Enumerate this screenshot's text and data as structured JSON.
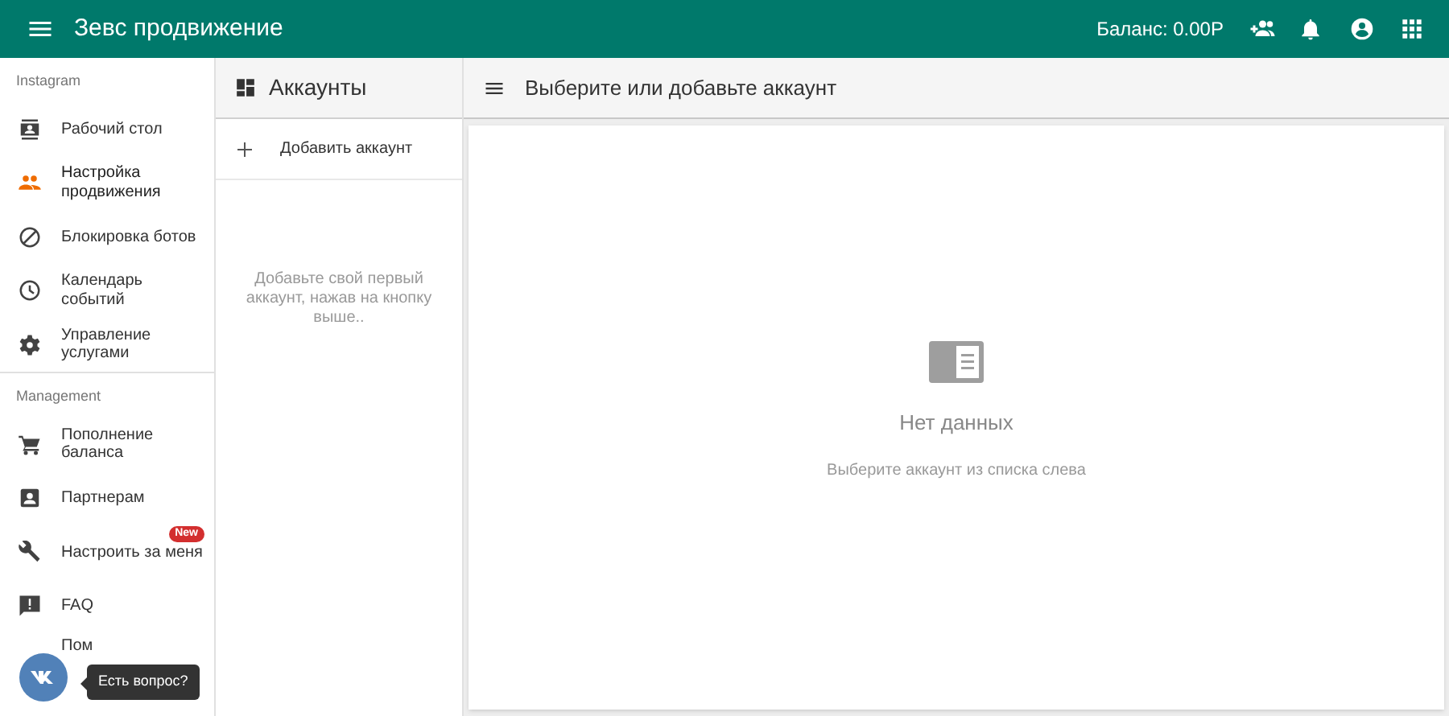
{
  "app_bar": {
    "title": "Зевс продвижение",
    "balance": "Баланс: 0.00Р"
  },
  "sidebar": {
    "sections": [
      {
        "heading": "Instagram",
        "items": [
          {
            "label": "Рабочий стол",
            "selected": false
          },
          {
            "label": "Настройка продвижения",
            "selected": true
          },
          {
            "label": "Блокировка ботов",
            "selected": false
          },
          {
            "label": "Календарь событий",
            "selected": false
          },
          {
            "label": "Управление услугами",
            "selected": false
          }
        ]
      },
      {
        "heading": "Management",
        "items": [
          {
            "label": "Пополнение баланса",
            "selected": false
          },
          {
            "label": "Партнерам",
            "selected": false
          },
          {
            "label": "Настроить за меня",
            "selected": false,
            "badge": "New"
          },
          {
            "label": "FAQ",
            "selected": false
          },
          {
            "label": "Пом",
            "selected": false
          }
        ]
      }
    ]
  },
  "accounts": {
    "title": "Аккаунты",
    "add_button": "Добавить аккаунт",
    "empty_text": "Добавьте свой первый аккаунт, нажав на кнопку выше.."
  },
  "main": {
    "title": "Выберите или добавьте аккаунт",
    "empty_title": "Нет данных",
    "empty_text": "Выберите аккаунт из списка слева"
  },
  "chat": {
    "tooltip": "Есть вопрос?"
  }
}
